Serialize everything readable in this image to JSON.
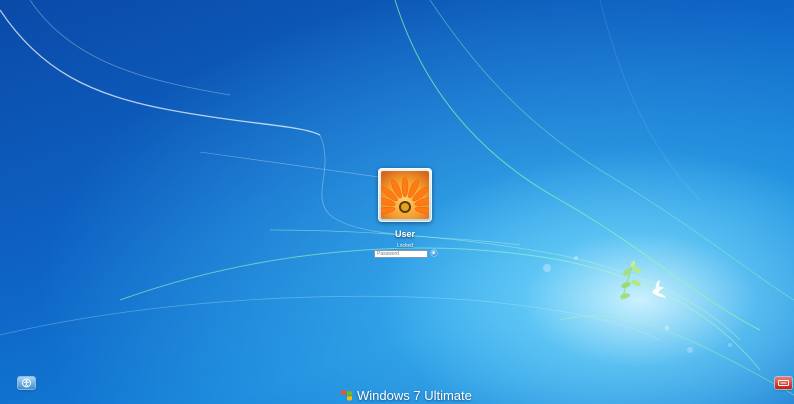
{
  "lock_screen": {
    "user_name": "User",
    "status_text": "Locked",
    "password_placeholder": "Password",
    "password_value": "",
    "avatar": "orange-flower-avatar"
  },
  "corner_buttons": {
    "left_icon": "ease-of-access-icon",
    "right_icon": "shutdown-icon"
  },
  "branding": {
    "logo_icon": "windows-logo-icon",
    "edition_text": "Windows 7 Ultimate"
  },
  "colors": {
    "wallpaper_dark": "#0a4aa8",
    "wallpaper_light": "#d2f5ff",
    "shutdown_red": "#c41d12",
    "text": "#ffffff"
  }
}
